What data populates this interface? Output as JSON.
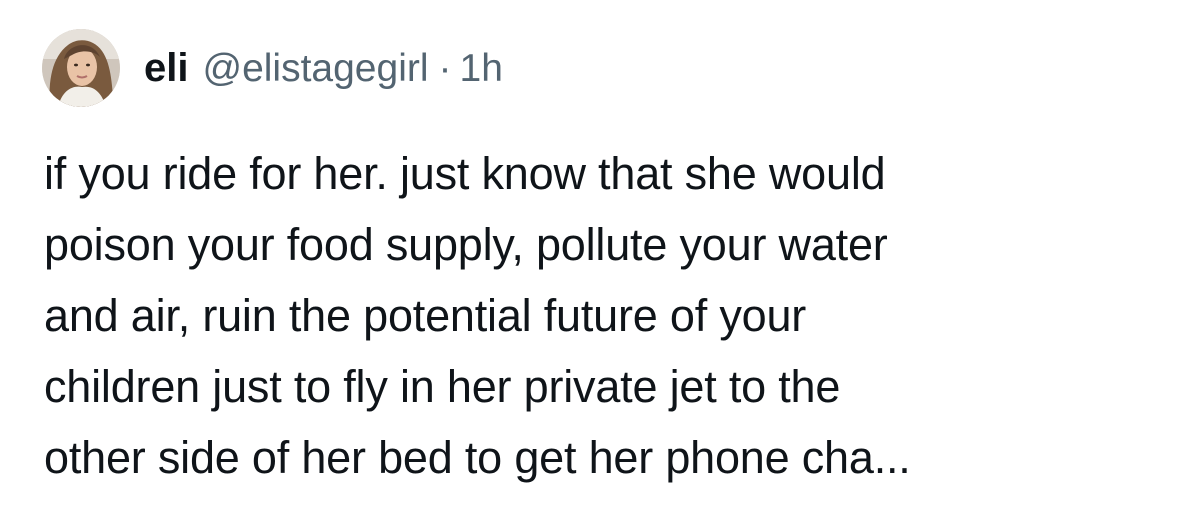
{
  "tweet": {
    "author": {
      "display_name": "eli",
      "handle": "@elistagegirl",
      "separator": "·",
      "time": "1h",
      "avatar_icon": "user-avatar-photo"
    },
    "text_lines": [
      "if you ride for her. just know that she would",
      "poison your food supply, pollute your water",
      "and air, ruin the potential future of your",
      "children just to fly in her private jet to the",
      "other side of her bed to get her phone cha..."
    ]
  },
  "colors": {
    "background": "#ffffff",
    "primary_text": "#0f1419",
    "secondary_text": "#536471"
  }
}
